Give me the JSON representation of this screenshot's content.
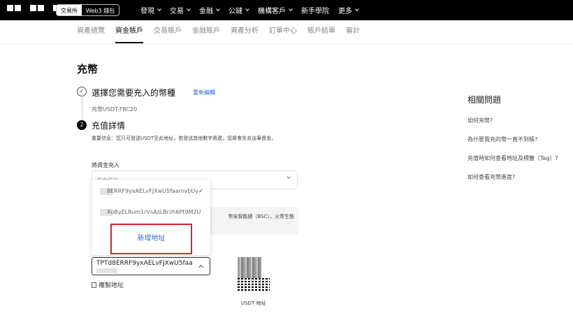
{
  "header": {
    "logo": "OKX",
    "switch": {
      "exchange": "交易所",
      "web3": "Web3 錢包"
    },
    "nav": [
      {
        "label": "發現",
        "has_menu": true
      },
      {
        "label": "交易",
        "has_menu": true
      },
      {
        "label": "金融",
        "has_menu": true
      },
      {
        "label": "公鏈",
        "has_menu": true
      },
      {
        "label": "機構客戶",
        "has_menu": true
      },
      {
        "label": "新手學院",
        "has_menu": false
      },
      {
        "label": "更多",
        "has_menu": true
      }
    ]
  },
  "subnav": {
    "tabs": [
      "資產總覽",
      "資金賬戶",
      "交易賬戶",
      "金融賬戶",
      "資產分析",
      "訂單中心",
      "賬戶結單",
      "審計"
    ],
    "active_index": 1
  },
  "page": {
    "title": "充幣",
    "step1": {
      "number": "✓",
      "title": "選擇您需要充入的幣種",
      "reselect": "重新編輯",
      "subtitle": "充幣USDT-TRC20"
    },
    "step2": {
      "number": "2",
      "title": "充值詳情",
      "notice": "重要信息：您只可發送USDT至此地址，若發送其他數字資產，您將會失去這筆資金。"
    },
    "deposit_to_label": "將資金充入",
    "deposit_to_value": "資金賬戶",
    "network_note": "幣安智能鏈（BSC），火幣生態",
    "dropdown": {
      "items": [
        {
          "address": "8ERRF9yxAELvFJXwU5faamvbUy",
          "selected": true
        },
        {
          "address": "XoByELRum1rVsAzLBrzh6Pt9M2U",
          "selected": false
        }
      ],
      "new_address": "新增地址"
    },
    "address_value": "TPTd8ERRF9yxAELvFJXwU5faa",
    "copy_label": "複製地址",
    "qr_label": "USDT 地址"
  },
  "sidebar": {
    "title": "相關問題",
    "links": [
      "如何充幣?",
      "為什麼我充的幣一直不到賬?",
      "充值時如何查看地址及標籤（Tag）?",
      "如何查看充幣進度?"
    ]
  },
  "colors": {
    "accent": "#2b6fd6",
    "highlight": "#d8232a"
  }
}
